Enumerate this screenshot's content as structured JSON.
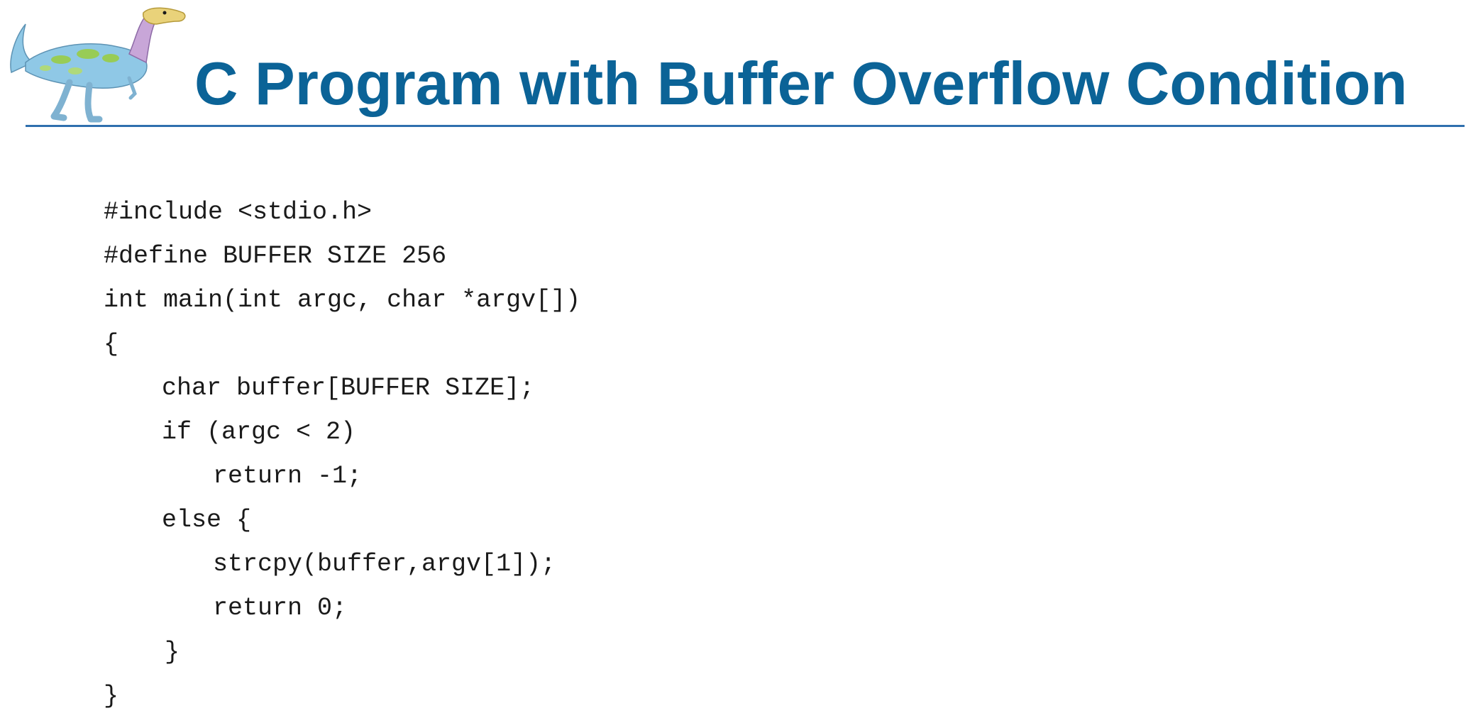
{
  "slide": {
    "title": "C Program with Buffer Overflow Condition",
    "logo": {
      "icon": "dinosaur-logo-icon",
      "colors": {
        "body": "#8fc8e6",
        "spots": "#9acd3c",
        "head": "#e9d27a",
        "neck_tint": "#c8a6d8"
      }
    },
    "colors": {
      "title": "#0b6397",
      "rule": "#2f6fae",
      "code_text": "#1a1a1a"
    }
  },
  "code": {
    "lines": [
      "#include <stdio.h>",
      "#define BUFFER SIZE 256",
      "int main(int argc, char *argv[])",
      "{",
      "char buffer[BUFFER SIZE];",
      "if (argc < 2)",
      "return -1;",
      "else {",
      "strcpy(buffer,argv[1]);",
      "return 0;",
      "}",
      "}"
    ]
  }
}
